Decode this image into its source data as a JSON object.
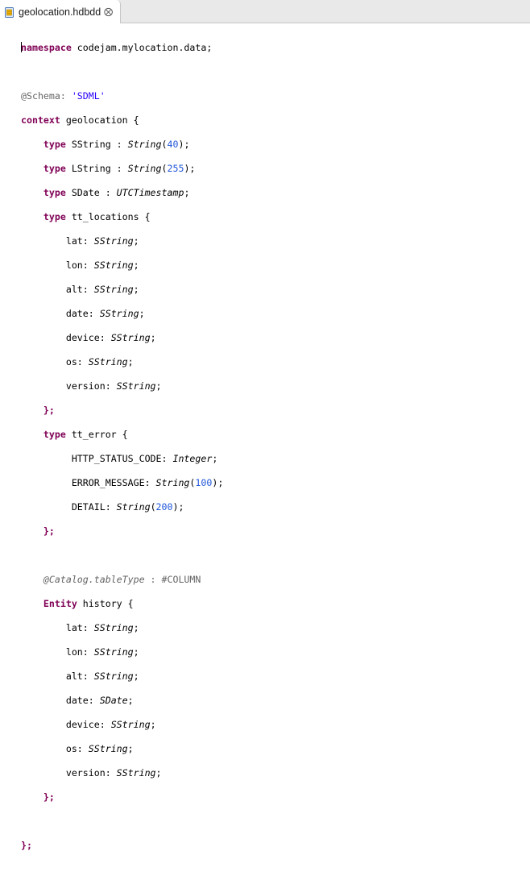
{
  "tab": {
    "title": "geolocation.hdbdd",
    "icon": "hdbdd-file-icon",
    "close_icon": "close-icon",
    "close_glyph": "⨂"
  },
  "code": {
    "namespace_kw": "namespace",
    "namespace_rest": " codejam.mylocation.data;",
    "schema_annotation": "@Schema: ",
    "schema_value": "'SDML'",
    "context_kw": "context",
    "context_rest": " geolocation {",
    "type_kw": "type",
    "sstring_decl": " SString : ",
    "sstring_type": "String",
    "sstring_len": "40",
    "lstring_decl": " LString : ",
    "lstring_type": "String",
    "lstring_len": "255",
    "sdate_decl": " SDate : ",
    "sdate_type": "UTCTimestamp",
    "tt_locations_decl": " tt_locations {",
    "loc_fields": [
      {
        "name": "lat: ",
        "type": "SString"
      },
      {
        "name": "lon: ",
        "type": "SString"
      },
      {
        "name": "alt: ",
        "type": "SString"
      },
      {
        "name": "date: ",
        "type": "SString"
      },
      {
        "name": "device: ",
        "type": "SString"
      },
      {
        "name": "os: ",
        "type": "SString"
      },
      {
        "name": "version: ",
        "type": "SString"
      }
    ],
    "close_brace": "};",
    "tt_error_decl": " tt_error {",
    "err_http_name": "HTTP_STATUS_CODE: ",
    "err_http_type": "Integer",
    "err_msg_name": "ERROR_MESSAGE: ",
    "err_msg_type": "String",
    "err_msg_len": "100",
    "err_detail_name": "DETAIL: ",
    "err_detail_type": "String",
    "err_detail_len": "200",
    "catalog_annotation": "@Catalog.tableType",
    "catalog_rest": " : #COLUMN",
    "entity_kw": "Entity",
    "entity_rest": " history {",
    "hist_fields": [
      {
        "name": "lat: ",
        "type": "SString"
      },
      {
        "name": "lon: ",
        "type": "SString"
      },
      {
        "name": "alt: ",
        "type": "SString"
      },
      {
        "name": "date: ",
        "type": "SDate"
      },
      {
        "name": "device: ",
        "type": "SString"
      },
      {
        "name": "os: ",
        "type": "SString"
      },
      {
        "name": "version: ",
        "type": "SString"
      }
    ]
  }
}
